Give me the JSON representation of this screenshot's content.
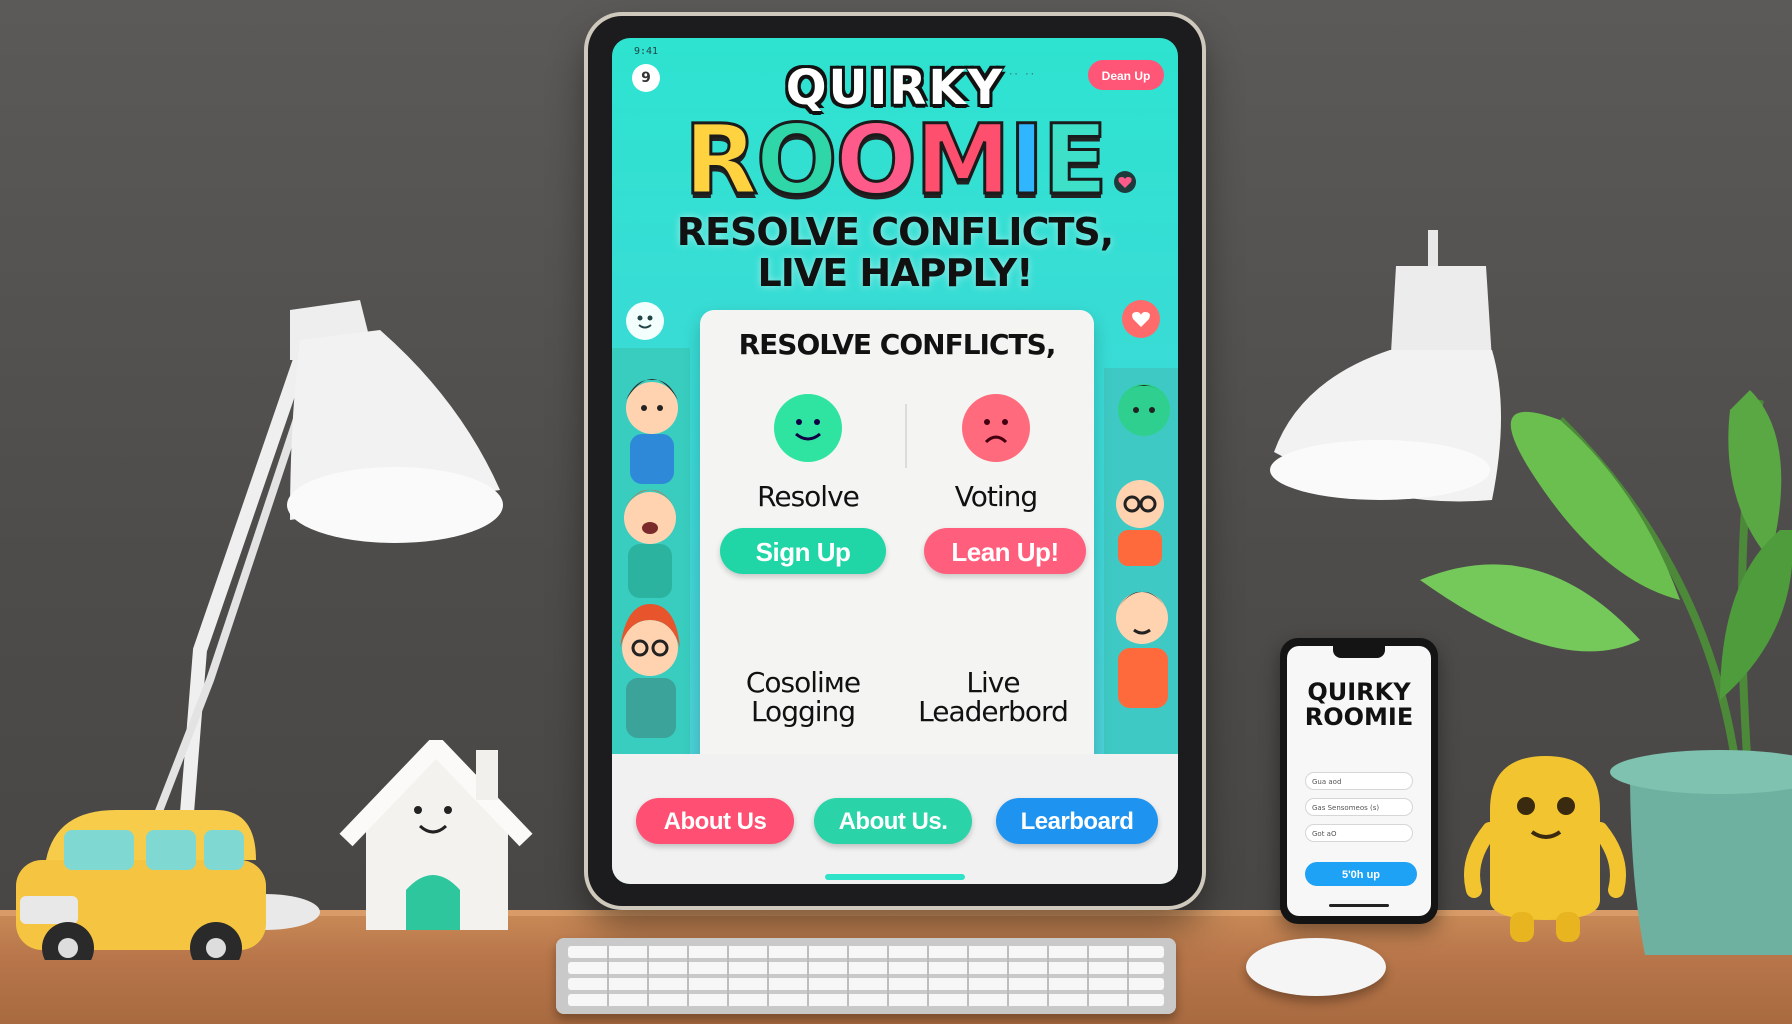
{
  "app": {
    "status_text": "9:41",
    "back_icon": "9",
    "mini_nav": "·· ··",
    "top_button": "Dean Up",
    "logo_top": "QUIRKY",
    "logo_main": [
      "R",
      "O",
      "O",
      "M",
      "I",
      "E"
    ],
    "logo_colors": [
      "#ffd23f",
      "#2fd6a8",
      "#ff5b8a",
      "#ff4f6e",
      "#2fb6ff",
      "#3fe0c8"
    ],
    "tagline_line1": "RESOLVE CONFLICTS,",
    "tagline_line2": "LIVE HAPPLY!"
  },
  "card": {
    "heading": "RESOLVE CONFLICTS,",
    "features": [
      {
        "label": "Resolve",
        "button": "Sign Up",
        "face_color": "#2ee4a0",
        "button_color": "#21d6a6",
        "mood": "happy"
      },
      {
        "label": "Voting",
        "button": "Lean Up!",
        "face_color": "#ff6b7d",
        "button_color": "#ff5f7c",
        "mood": "sad"
      }
    ],
    "bottom_features": [
      {
        "line1": "Cosoliме",
        "line2": "Logging"
      },
      {
        "line1": "Live",
        "line2": "Leaderbord"
      }
    ]
  },
  "bottom_nav": [
    {
      "label": "About Us",
      "color": "#ff4f72"
    },
    {
      "label": "About Us.",
      "color": "#2ad4a8"
    },
    {
      "label": "Learboard",
      "color": "#1e94f0"
    }
  ],
  "phone": {
    "title_line1": "QUIRKY",
    "title_line2": "ROOMIE",
    "fields": [
      "Gua aod",
      "Gas Sensomeos (s)",
      "Got aO"
    ],
    "button": "5'0h up"
  }
}
